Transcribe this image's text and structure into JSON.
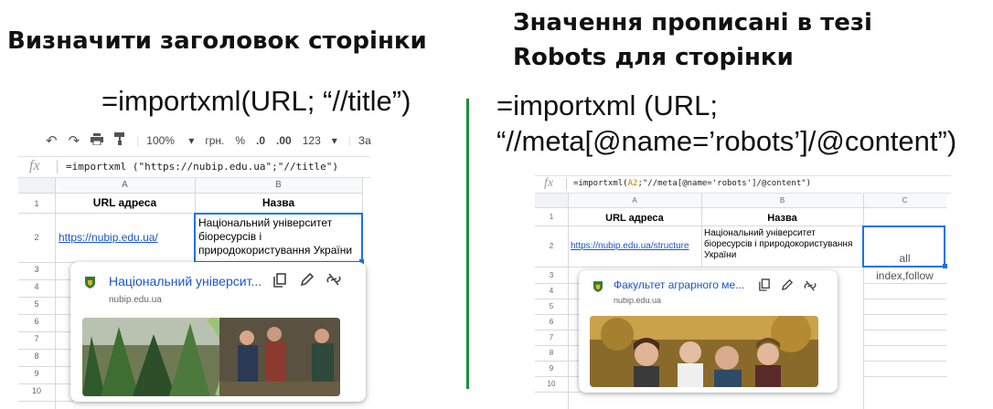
{
  "left": {
    "heading": "Визначити заголовок сторінки",
    "formula_caption": "=importxml(URL; “//title”)",
    "toolbar": {
      "zoom": "100%",
      "currency": "грн.",
      "percent": "%",
      "dec_less": ".0",
      "dec_more": ".00",
      "format": "123",
      "more": "За"
    },
    "formula_bar": {
      "fx": "fx",
      "text": "=importxml (\"https://nubip.edu.ua\";\"//title\")"
    },
    "columns": [
      "A",
      "B"
    ],
    "rows": [
      "1",
      "2",
      "3",
      "4",
      "5",
      "6",
      "7",
      "8",
      "9",
      "10"
    ],
    "cells": {
      "a1": "URL адреса",
      "b1": "Назва",
      "a2": "https://nubip.edu.ua/",
      "b2": "Національний університет біоресурсів і природокористування України"
    },
    "chip": {
      "title": "Національний університ...",
      "domain": "nubip.edu.ua"
    }
  },
  "right": {
    "heading_line1": "Значення прописані в тезі",
    "heading_line2": "Robots для сторінки",
    "formula_caption_line1": "=importxml (URL;",
    "formula_caption_line2": "“//meta[@name=’robots’]/@content”)",
    "formula_bar": {
      "fx": "fx",
      "prefix": "=importxml(",
      "ref": "A2",
      "suffix": ";\"//meta[@name='robots']/@content\")"
    },
    "columns": [
      "A",
      "B",
      "C"
    ],
    "rows": [
      "1",
      "2",
      "3",
      "4",
      "5",
      "6",
      "7",
      "8",
      "9",
      "10"
    ],
    "cells": {
      "a1": "URL адреса",
      "b1": "Назва",
      "a2": "https://nubip.edu.ua/structure",
      "b2": "Національний університет біоресурсів і природокористування України",
      "c2": "all",
      "c3": "index,follow"
    },
    "chip": {
      "title": "Факультет аграрного ме...",
      "domain": "nubip.edu.ua"
    }
  },
  "icons": [
    "undo-icon",
    "redo-icon",
    "print-icon",
    "paint-format-icon",
    "copy-icon",
    "edit-icon",
    "unlink-icon",
    "site-favicon-icon"
  ],
  "colors": {
    "link": "#1a55c8",
    "selection": "#1a73e8",
    "divider": "#1b8f3a"
  }
}
